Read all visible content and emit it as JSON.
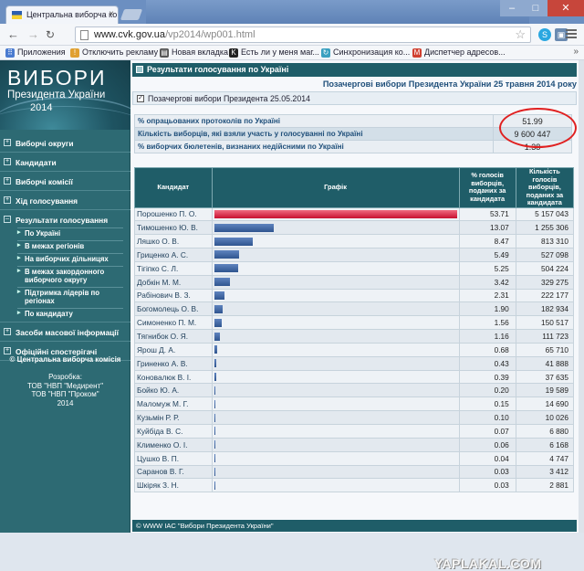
{
  "browser": {
    "tab_title": "Центральна виборча ко",
    "tab_close": "×",
    "url_host": "www.cvk.gov.ua",
    "url_path": "/vp2014/wp001.html",
    "bookmarks": [
      {
        "label": "Приложения",
        "color": "#4a7bd0",
        "glyph": "⠿"
      },
      {
        "label": "Отключить рекламу",
        "color": "#e0a030",
        "glyph": "!"
      },
      {
        "label": "Новая вкладка",
        "color": "#555555",
        "glyph": "▤"
      },
      {
        "label": "Есть ли у меня маг...",
        "color": "#222222",
        "glyph": "K"
      },
      {
        "label": "Синхронизация ко...",
        "color": "#3aa0c0",
        "glyph": "↻"
      },
      {
        "label": "Диспетчер адресов...",
        "color": "#d04030",
        "glyph": "M"
      }
    ],
    "bookmarks_more": "»"
  },
  "sidebar": {
    "logo_line1": "ВИБОРИ",
    "logo_line2": "Президента України",
    "logo_line3": "2014",
    "items": [
      {
        "label": "Виборчі округи"
      },
      {
        "label": "Кандидати"
      },
      {
        "label": "Виборчі комісії"
      },
      {
        "label": "Хід голосування"
      }
    ],
    "results_section": {
      "label": "Результати голосування",
      "subitems": [
        "По Україні",
        "В межах регіонів",
        "На виборчих дільницях",
        "В межах закордонного виборчого округу",
        "Підтримка лідерів по регіонах",
        "По кандидату"
      ]
    },
    "items_after": [
      {
        "label": "Засоби масової інформації"
      },
      {
        "label": "Офіційні спостерігачі"
      }
    ],
    "copyright": "© Центральна виборча комісія",
    "dev_lines": [
      "Розробка:",
      "ТОВ \"НВП \"Медирент\"",
      "ТОВ \"НВП \"Проком\"",
      "2014"
    ]
  },
  "main": {
    "title": "Результати голосування по Україні",
    "subtitle": "Позачергові вибори Президента України 25 травня 2014 року",
    "election_label": "Позачергові вибори Президента 25.05.2014",
    "stats": [
      {
        "label": "% опрацьованих протоколів по Україні",
        "value": "51.99"
      },
      {
        "label": "Кількість виборців, які взяли участь у голосуванні по Україні",
        "value": "9 600 447"
      },
      {
        "label": "% виборчих бюлетенів, визнаних недійсними по Україні",
        "value": "1.38"
      }
    ],
    "table_headers": {
      "candidate": "Кандидат",
      "graph": "Графік",
      "pct": "% голосів виборців, поданих за кандидата",
      "count": "Кількість голосів виборців, поданих за кандидата"
    },
    "candidates": [
      {
        "name": "Порошенко П. О.",
        "pct": "53.71",
        "votes": "5 157 043"
      },
      {
        "name": "Тимошенко Ю. В.",
        "pct": "13.07",
        "votes": "1 255 306"
      },
      {
        "name": "Ляшко О. В.",
        "pct": "8.47",
        "votes": "813 310"
      },
      {
        "name": "Гриценко А. С.",
        "pct": "5.49",
        "votes": "527 098"
      },
      {
        "name": "Тігіпко С. Л.",
        "pct": "5.25",
        "votes": "504 224"
      },
      {
        "name": "Добкін М. М.",
        "pct": "3.42",
        "votes": "329 275"
      },
      {
        "name": "Рабінович В. З.",
        "pct": "2.31",
        "votes": "222 177"
      },
      {
        "name": "Богомолець О. В.",
        "pct": "1.90",
        "votes": "182 934"
      },
      {
        "name": "Симоненко П. М.",
        "pct": "1.56",
        "votes": "150 517"
      },
      {
        "name": "Тягнибок О. Я.",
        "pct": "1.16",
        "votes": "111 723"
      },
      {
        "name": "Ярош Д. А.",
        "pct": "0.68",
        "votes": "65 710"
      },
      {
        "name": "Гриненко А. В.",
        "pct": "0.43",
        "votes": "41 888"
      },
      {
        "name": "Коновалюк В. І.",
        "pct": "0.39",
        "votes": "37 635"
      },
      {
        "name": "Бойко Ю. А.",
        "pct": "0.20",
        "votes": "19 589"
      },
      {
        "name": "Маломуж М. Г.",
        "pct": "0.15",
        "votes": "14 690"
      },
      {
        "name": "Кузьмін Р. Р.",
        "pct": "0.10",
        "votes": "10 026"
      },
      {
        "name": "Куйбіда В. С.",
        "pct": "0.07",
        "votes": "6 880"
      },
      {
        "name": "Клименко О. І.",
        "pct": "0.06",
        "votes": "6 168"
      },
      {
        "name": "Цушко В. П.",
        "pct": "0.04",
        "votes": "4 747"
      },
      {
        "name": "Саранов В. Г.",
        "pct": "0.03",
        "votes": "3 412"
      },
      {
        "name": "Шкіряк З. Н.",
        "pct": "0.03",
        "votes": "2 881"
      }
    ],
    "footer": "© WWW ІАС \"Вибори Президента України\""
  },
  "watermark": "YAPLAKAL.COM"
}
